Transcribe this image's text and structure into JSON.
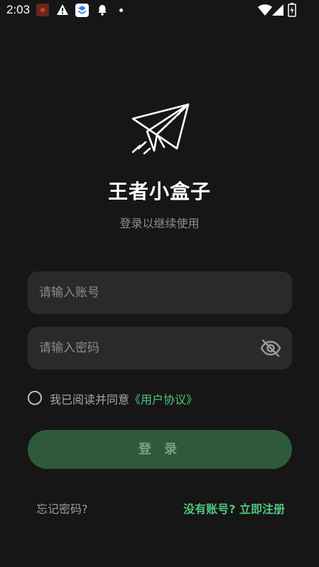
{
  "status_bar": {
    "time": "2:03"
  },
  "colors": {
    "background": "#161616",
    "field_background": "#2a2a2a",
    "accent_green": "#4fc77e",
    "login_button": "#2e5a3b"
  },
  "icons": {
    "logo": "paper-plane-icon",
    "password_toggle": "eye-off-icon"
  },
  "header": {
    "title": "王者小盒子",
    "subtitle": "登录以继续使用"
  },
  "form": {
    "account_placeholder": "请输入账号",
    "password_placeholder": "请输入密码",
    "agreement_text": "我已阅读并同意",
    "agreement_link": "《用户协议》",
    "login_label": "登 录"
  },
  "footer": {
    "forgot_password": "忘记密码?",
    "register": "没有账号? 立即注册"
  }
}
